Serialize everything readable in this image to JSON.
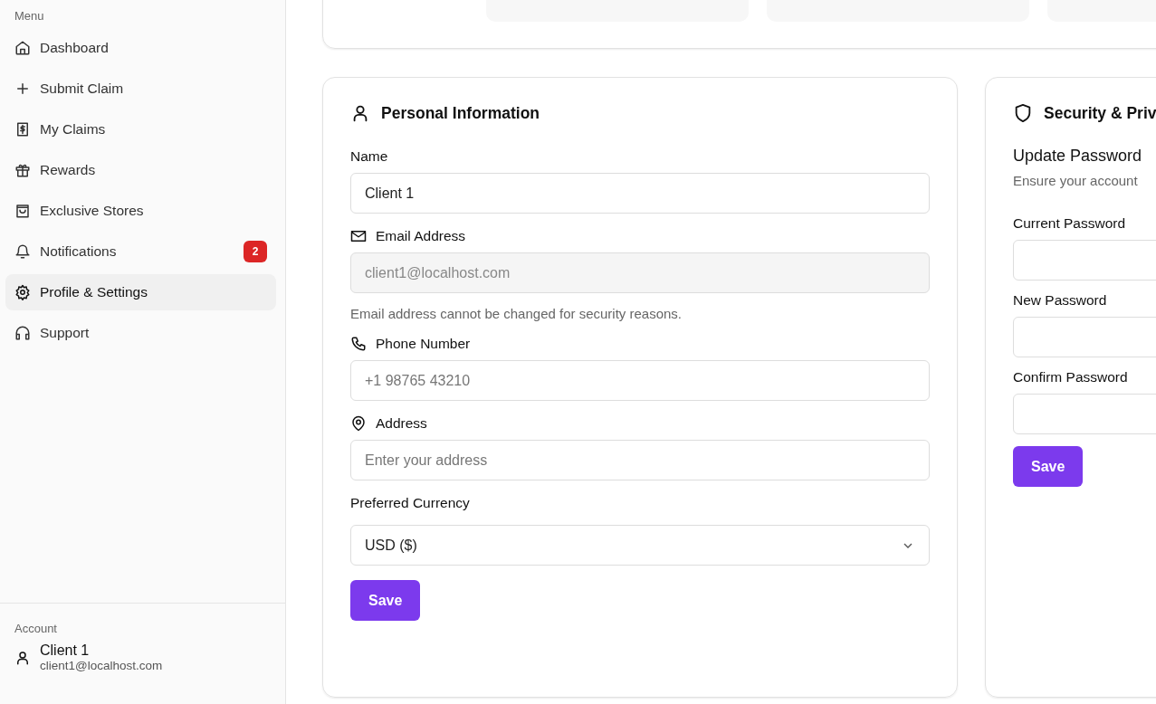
{
  "sidebar": {
    "menu_label": "Menu",
    "items": [
      {
        "label": "Dashboard",
        "selected": false
      },
      {
        "label": "Submit Claim",
        "selected": false
      },
      {
        "label": "My Claims",
        "selected": false
      },
      {
        "label": "Rewards",
        "selected": false
      },
      {
        "label": "Exclusive Stores",
        "selected": false
      },
      {
        "label": "Notifications",
        "selected": false,
        "badge": "2"
      },
      {
        "label": "Profile & Settings",
        "selected": true
      },
      {
        "label": "Support",
        "selected": false
      }
    ],
    "account_label": "Account",
    "user": {
      "name": "Client 1",
      "email": "client1@localhost.com"
    }
  },
  "personal": {
    "title": "Personal Information",
    "fields": [
      {
        "kind": "text",
        "label": "Name",
        "value": "Client 1"
      },
      {
        "kind": "text",
        "label": "Email Address",
        "value": "client1@localhost.com",
        "disabled": true,
        "hint": "Email address cannot be changed for security reasons."
      },
      {
        "kind": "text",
        "label": "Phone Number",
        "placeholder": "+1 98765 43210"
      },
      {
        "kind": "text",
        "label": "Address",
        "placeholder": "Enter your address"
      },
      {
        "kind": "select",
        "label": "Preferred Currency",
        "value": "USD ($)"
      }
    ],
    "save": "Save"
  },
  "security": {
    "title": "Security & Priv",
    "subtitle": "Update Password",
    "description": "Ensure your account",
    "fields": [
      {
        "label": "Current Password"
      },
      {
        "label": "New Password"
      },
      {
        "label": "Confirm Password"
      }
    ],
    "save": "Save"
  }
}
